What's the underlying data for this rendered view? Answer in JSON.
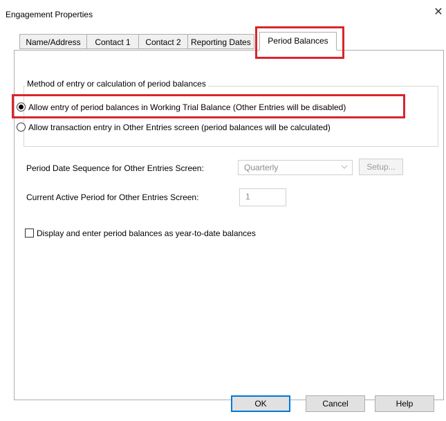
{
  "window": {
    "title": "Engagement Properties",
    "close_glyph": "✕"
  },
  "tabs": [
    {
      "label": "Name/Address",
      "active": false
    },
    {
      "label": "Contact 1",
      "active": false
    },
    {
      "label": "Contact 2",
      "active": false
    },
    {
      "label": "Reporting Dates",
      "active": false
    },
    {
      "label": "Period Balances",
      "active": true
    }
  ],
  "method_group": {
    "label": "Method of entry or calculation of period balances",
    "options": [
      {
        "label": "Allow entry of period balances in Working Trial Balance (Other Entries will be disabled)",
        "selected": true
      },
      {
        "label": "Allow transaction entry in Other Entries screen (period balances will be calculated)",
        "selected": false
      }
    ]
  },
  "period_sequence": {
    "label": "Period Date Sequence for Other Entries Screen:",
    "value": "Quarterly",
    "setup_label": "Setup..."
  },
  "active_period": {
    "label": "Current Active Period for Other Entries Screen:",
    "value": "1"
  },
  "ytd_checkbox": {
    "label": "Display and enter period balances as year-to-date balances",
    "checked": false
  },
  "buttons": {
    "ok": "OK",
    "cancel": "Cancel",
    "help": "Help"
  },
  "colors": {
    "highlight": "#d9252b",
    "disabled_text": "#8a8a8a"
  },
  "icons": {
    "close": "close-icon",
    "dropdown": "chevron-down-icon"
  }
}
